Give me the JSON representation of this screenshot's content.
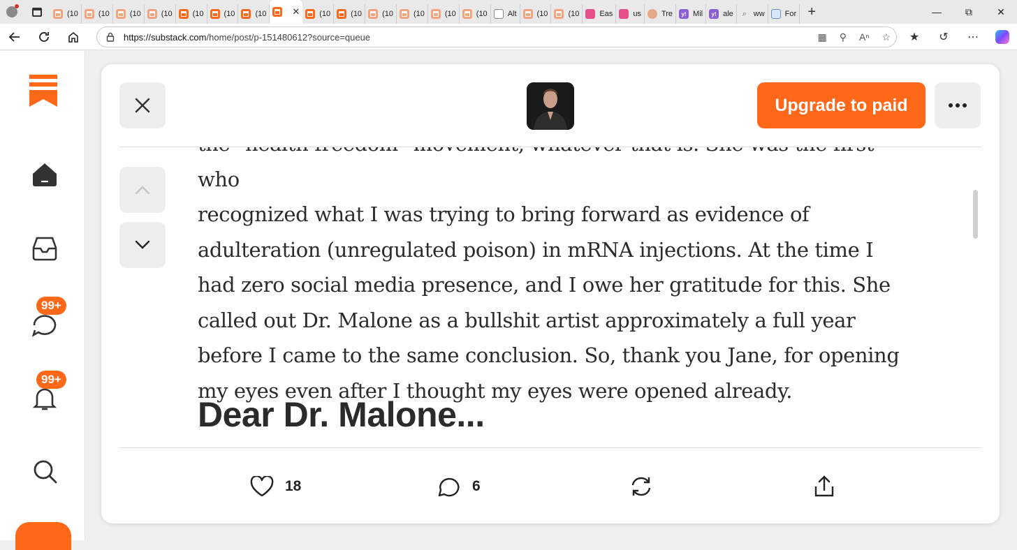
{
  "browser": {
    "tabs": [
      {
        "label": "(10",
        "favicon": "substack-icon"
      },
      {
        "label": "(10",
        "favicon": "substack-icon"
      },
      {
        "label": "(10",
        "favicon": "substack-icon"
      },
      {
        "label": "(10",
        "favicon": "substack-icon"
      },
      {
        "label": "(10",
        "favicon": "substack-icon"
      },
      {
        "label": "(10",
        "favicon": "substack-icon"
      },
      {
        "label": "(10",
        "favicon": "substack-icon"
      },
      {
        "label": "",
        "favicon": "substack-icon",
        "active": true
      },
      {
        "label": "(10",
        "favicon": "substack-icon"
      },
      {
        "label": "(10",
        "favicon": "substack-icon"
      },
      {
        "label": "(10",
        "favicon": "substack-icon"
      },
      {
        "label": "(10",
        "favicon": "substack-icon"
      },
      {
        "label": "(10",
        "favicon": "substack-icon"
      },
      {
        "label": "(10",
        "favicon": "substack-icon"
      },
      {
        "label": "Alt",
        "favicon": "document-icon"
      },
      {
        "label": "(10",
        "favicon": "substack-icon"
      },
      {
        "label": "(10",
        "favicon": "substack-icon"
      },
      {
        "label": "Eas",
        "favicon": "youtube-icon"
      },
      {
        "label": "us",
        "favicon": "youtube-icon"
      },
      {
        "label": "Tre",
        "favicon": "circle-icon"
      },
      {
        "label": "Mil",
        "favicon": "yahoo-icon"
      },
      {
        "label": "ale",
        "favicon": "yahoo-icon"
      },
      {
        "label": "ww",
        "favicon": "search-icon"
      },
      {
        "label": "For",
        "favicon": "web-icon"
      }
    ],
    "url_host": "https://substack.com",
    "url_path": "/home/post/p-151480612?source=queue"
  },
  "sidebar": {
    "chat_badge": "99+",
    "activity_badge": "99+"
  },
  "post": {
    "upgrade_label": "Upgrade to paid",
    "clipped_line": "the \"health freedom\" movement, whatever that is. She was the first who",
    "lines": [
      "recognized what I was trying to bring forward as evidence of",
      "adulteration (unregulated poison) in mRNA injections. At the time I",
      "had zero social media presence, and I owe her gratitude for this. She",
      "called out Dr. Malone as a bullshit artist approximately a full year",
      "before I came to the same conclusion. So, thank you Jane, for opening",
      "my eyes even after I thought my eyes were opened already."
    ],
    "heading": "Dear Dr. Malone...",
    "likes": "18",
    "comments": "6"
  },
  "colors": {
    "accent": "#ff6719",
    "text": "#2b2b2b"
  }
}
